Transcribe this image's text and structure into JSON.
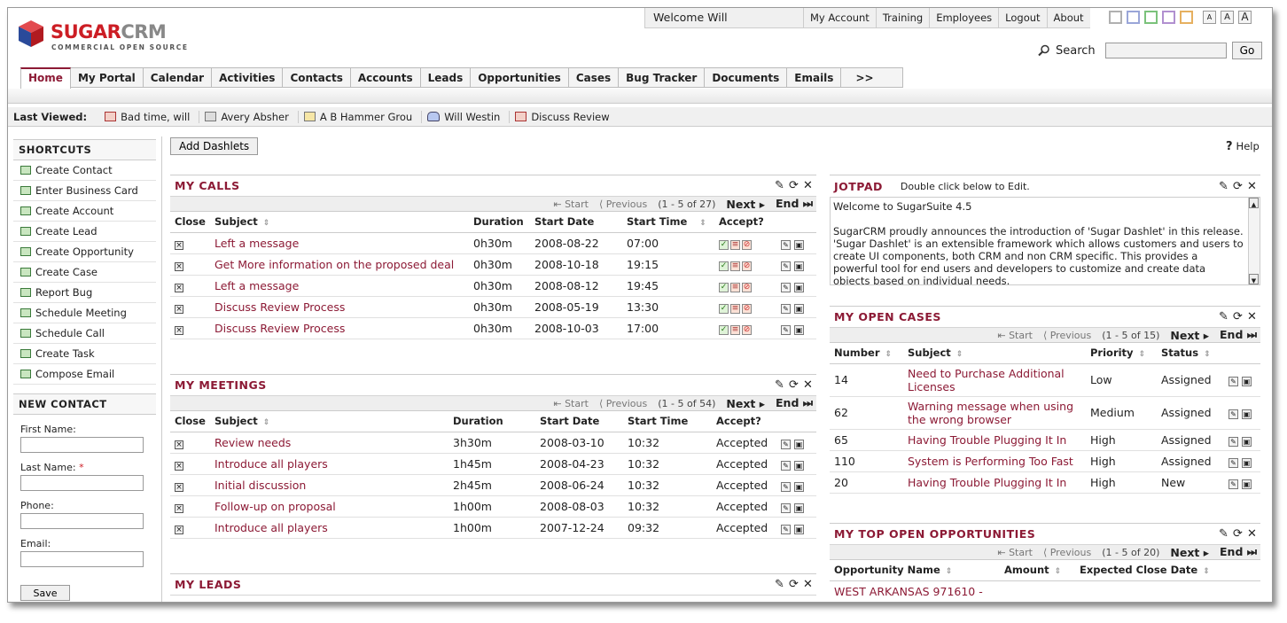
{
  "header": {
    "brand_main": "SUGAR",
    "brand_accent": "CRM",
    "tagline": "COMMERCIAL OPEN SOURCE",
    "welcome": "Welcome Will",
    "toplinks": [
      "My Account",
      "Training",
      "Employees",
      "Logout",
      "About"
    ],
    "font_buttons": [
      "A",
      "A",
      "A"
    ],
    "search_label": "Search",
    "search_value": "",
    "go_label": "Go"
  },
  "theme_colors": [
    "#b0b0b0",
    "#9aa6d8",
    "#7bc27b",
    "#b190d0",
    "#e6b060"
  ],
  "tabs": [
    "Home",
    "My Portal",
    "Calendar",
    "Activities",
    "Contacts",
    "Accounts",
    "Leads",
    "Opportunities",
    "Cases",
    "Bug Tracker",
    "Documents",
    "Emails",
    ">>"
  ],
  "active_tab": "Home",
  "last_viewed": {
    "label": "Last Viewed:",
    "items": [
      {
        "icon": "meeting-icon",
        "text": "Bad time, will"
      },
      {
        "icon": "contact-icon",
        "text": "Avery Absher"
      },
      {
        "icon": "account-icon",
        "text": "A B Hammer Grou"
      },
      {
        "icon": "people-icon",
        "text": "Will Westin"
      },
      {
        "icon": "meeting-icon",
        "text": "Discuss Review"
      }
    ]
  },
  "shortcuts": {
    "title": "SHORTCUTS",
    "items": [
      "Create Contact",
      "Enter Business Card",
      "Create Account",
      "Create Lead",
      "Create Opportunity",
      "Create Case",
      "Report Bug",
      "Schedule Meeting",
      "Schedule Call",
      "Create Task",
      "Compose Email"
    ]
  },
  "new_contact": {
    "title": "NEW CONTACT",
    "first_name": "First Name:",
    "last_name": "Last Name:",
    "required": "*",
    "phone": "Phone:",
    "email": "Email:",
    "save": "Save"
  },
  "add_dashlets": "Add Dashlets",
  "help": "Help",
  "pager_labels": {
    "start": "Start",
    "previous": "Previous",
    "next": "Next",
    "end": "End"
  },
  "my_calls": {
    "title": "MY CALLS",
    "count": "(1 - 5 of 27)",
    "columns": [
      "Close",
      "Subject",
      "Duration",
      "Start Date",
      "Start Time",
      "Accept?"
    ],
    "rows": [
      {
        "subject": "Left a message",
        "duration": "0h30m",
        "date": "2008-08-22",
        "time": "07:00"
      },
      {
        "subject": "Get More information on the proposed deal",
        "duration": "0h30m",
        "date": "2008-10-18",
        "time": "19:15"
      },
      {
        "subject": "Left a message",
        "duration": "0h30m",
        "date": "2008-08-12",
        "time": "19:45"
      },
      {
        "subject": "Discuss Review Process",
        "duration": "0h30m",
        "date": "2008-05-19",
        "time": "13:30"
      },
      {
        "subject": "Discuss Review Process",
        "duration": "0h30m",
        "date": "2008-10-03",
        "time": "17:00"
      }
    ]
  },
  "my_meetings": {
    "title": "MY MEETINGS",
    "count": "(1 - 5 of 54)",
    "columns": [
      "Close",
      "Subject",
      "Duration",
      "Start Date",
      "Start Time",
      "Accept?"
    ],
    "rows": [
      {
        "subject": "Review needs",
        "duration": "3h30m",
        "date": "2008-03-10",
        "time": "10:32",
        "accept": "Accepted"
      },
      {
        "subject": "Introduce all players",
        "duration": "1h45m",
        "date": "2008-04-23",
        "time": "10:32",
        "accept": "Accepted"
      },
      {
        "subject": "Initial discussion",
        "duration": "2h45m",
        "date": "2008-06-24",
        "time": "10:32",
        "accept": "Accepted"
      },
      {
        "subject": "Follow-up on proposal",
        "duration": "1h00m",
        "date": "2008-08-03",
        "time": "10:32",
        "accept": "Accepted"
      },
      {
        "subject": "Introduce all players",
        "duration": "1h00m",
        "date": "2007-12-24",
        "time": "09:32",
        "accept": "Accepted"
      }
    ]
  },
  "my_leads": {
    "title": "MY LEADS"
  },
  "jotpad": {
    "title": "JOTPAD",
    "note": "Double click below to Edit.",
    "line1": "Welcome to SugarSuite 4.5",
    "body": "SugarCRM proudly announces the introduction of 'Sugar Dashlet' in this release. 'Sugar Dashlet' is an extensible framework which allows customers and users to create UI components, both CRM and non CRM specific. This provides a powerful tool for end users and developers to customize and create data objects based on individual needs."
  },
  "my_open_cases": {
    "title": "MY OPEN CASES",
    "count": "(1 - 5 of 15)",
    "columns": [
      "Number",
      "Subject",
      "Priority",
      "Status"
    ],
    "rows": [
      {
        "number": "14",
        "subject": "Need to Purchase Additional Licenses",
        "priority": "Low",
        "status": "Assigned"
      },
      {
        "number": "62",
        "subject": "Warning message when using the wrong browser",
        "priority": "Medium",
        "status": "Assigned"
      },
      {
        "number": "65",
        "subject": "Having Trouble Plugging It In",
        "priority": "High",
        "status": "Assigned"
      },
      {
        "number": "110",
        "subject": "System is Performing Too Fast",
        "priority": "High",
        "status": "Assigned"
      },
      {
        "number": "20",
        "subject": "Having Trouble Plugging It In",
        "priority": "High",
        "status": "New"
      }
    ]
  },
  "my_top_opps": {
    "title": "MY TOP OPEN OPPORTUNITIES",
    "count": "(1 - 5 of 20)",
    "columns": [
      "Opportunity Name",
      "Amount",
      "Expected Close Date"
    ],
    "rows": [
      {
        "name": "WEST ARKANSAS 971610 -",
        "amount": "",
        "date": ""
      }
    ]
  }
}
